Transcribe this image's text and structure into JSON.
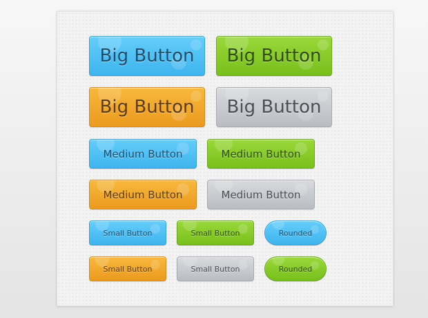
{
  "buttons": {
    "big_blue": "Big Button",
    "big_green": "Big Button",
    "big_orange": "Big Button",
    "big_gray": "Big Button",
    "medium_blue": "Medium Button",
    "medium_green": "Medium Button",
    "medium_orange": "Medium Button",
    "medium_gray": "Medium Button",
    "small_blue": "Small Button",
    "small_green": "Small Button",
    "rounded_blue": "Rounded",
    "small_orange": "Small Button",
    "small_gray": "Small Button",
    "rounded_green": "Rounded"
  },
  "colors": {
    "blue": "#4fc1f5",
    "green": "#86c926",
    "orange": "#f0a829",
    "gray": "#c5c8cc",
    "background": "#f3f3f3"
  }
}
